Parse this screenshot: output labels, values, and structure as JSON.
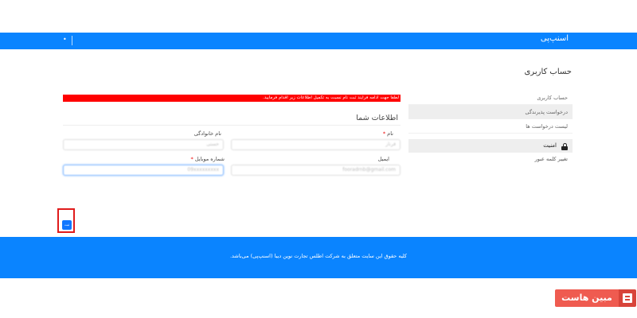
{
  "header": {
    "brand": "اسنپ‌پی",
    "menu_dot": "•"
  },
  "page": {
    "title": "حساب کاربری"
  },
  "sidebar": {
    "items": [
      {
        "label": "حساب کاربری"
      },
      {
        "label": "درخواست پذیرندگی"
      },
      {
        "label": "لیست درخواست ها"
      }
    ],
    "security": {
      "header": "امنیت",
      "change_password": "تغییر کلمه عبور",
      "icon": "lock-icon"
    }
  },
  "alert": {
    "text": "لطفا جهت ادامه فرایند ثبت نام نسبت به تکمیل اطلاعات زیر اقدام فرمایید.",
    "color": "#ff0000"
  },
  "form": {
    "section_title": "اطلاعات شما",
    "first_name": {
      "label": "نام",
      "required": "*",
      "value": "فرناز"
    },
    "last_name": {
      "label": "نام خانوادگی",
      "value": "حسنی"
    },
    "email": {
      "label": "ایمیل",
      "value": "fooradrnb@gmail.com"
    },
    "mobile": {
      "label": "شماره موبایل",
      "required": "*",
      "value": "09xxxxxxxxx"
    },
    "submit": "ثبت"
  },
  "footer": {
    "text": "کلیه حقوق این سایت متعلق به شرکت اطلس تجارت نوین دیبا (اسنپ‌پی) می‌باشد."
  },
  "watermark": {
    "text": "مبین هاست"
  },
  "colors": {
    "primary": "#0a84ff",
    "alert": "#ff0000",
    "watermark": "#ef5b50",
    "highlight_box": "#e01b1b"
  }
}
